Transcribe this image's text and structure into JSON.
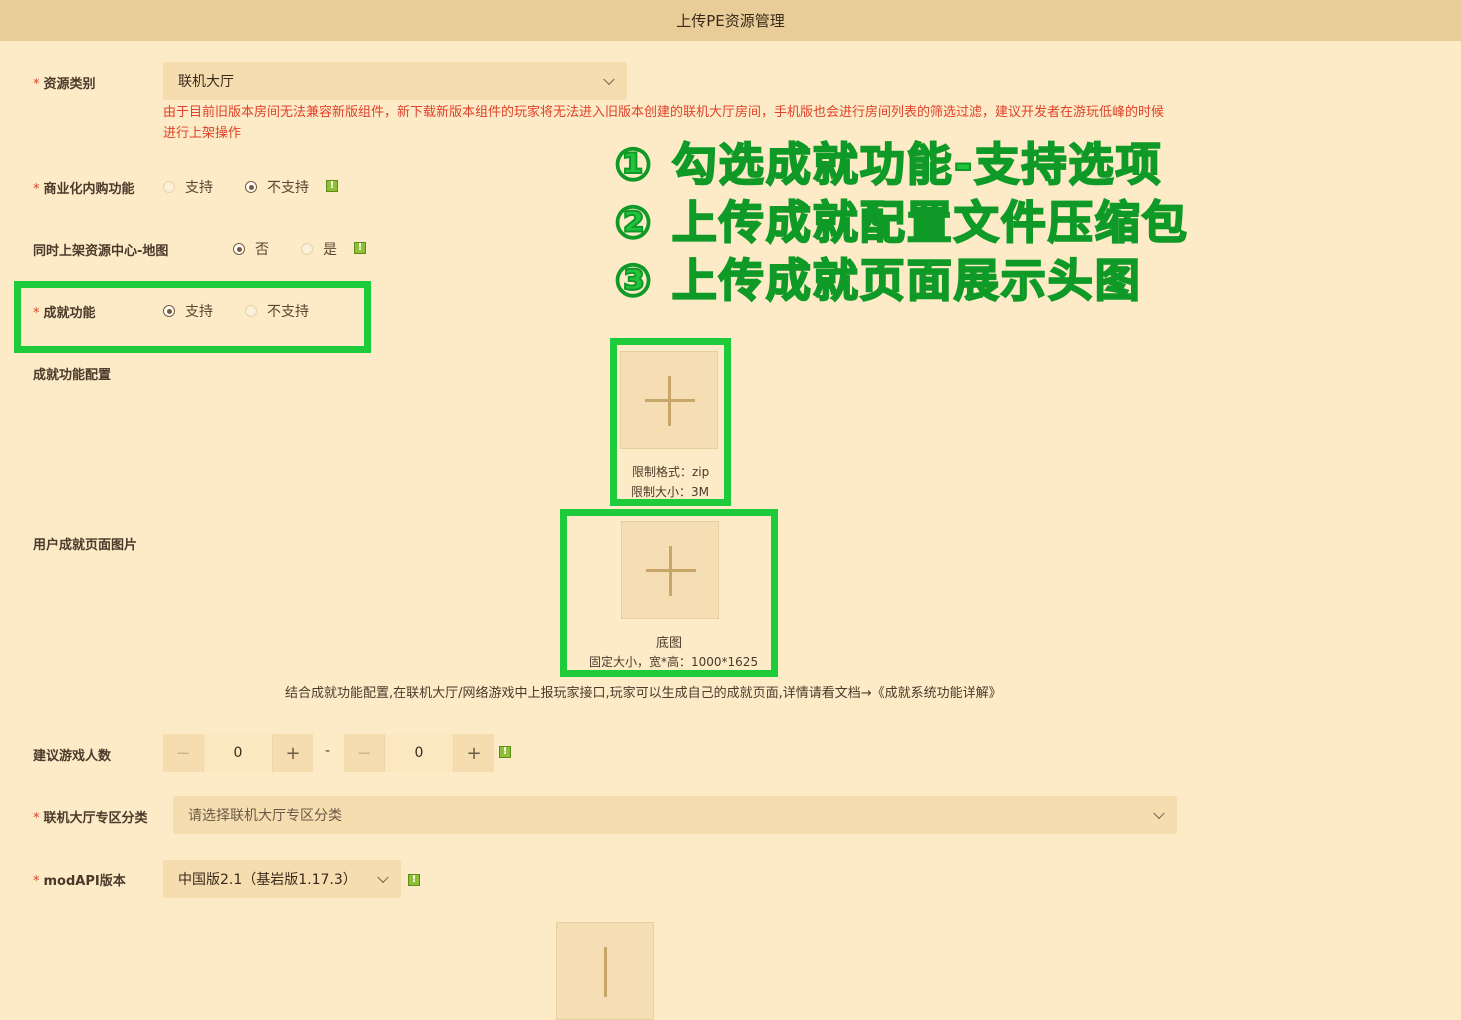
{
  "window": {
    "title": "上传PE资源管理"
  },
  "form": {
    "resource_type": {
      "label": "资源类别",
      "value": "联机大厅"
    },
    "warning": "由于目前旧版本房间无法兼容新版组件，新下载新版本组件的玩家将无法进入旧版本创建的联机大厅房间，手机版也会进行房间列表的筛选过滤，建议开发者在游玩低峰的时候进行上架操作",
    "commercial": {
      "label": "商业化内购功能",
      "options": [
        "支持",
        "不支持"
      ],
      "selected": "不支持"
    },
    "sync_map": {
      "label": "同时上架资源中心-地图",
      "options": [
        "否",
        "是"
      ],
      "selected": "否"
    },
    "achievement": {
      "label": "成就功能",
      "options": [
        "支持",
        "不支持"
      ],
      "selected": "支持"
    },
    "achievement_config": {
      "label": "成就功能配置",
      "hint_format": "限制格式：zip",
      "hint_size": "限制大小：3M"
    },
    "achievement_image": {
      "label": "用户成就页面图片",
      "caption": "底图",
      "size_hint": "固定大小，宽*高：1000*1625"
    },
    "achievement_desc": "结合成就功能配置,在联机大厅/网络游戏中上报玩家接口,玩家可以生成自己的成就页面,详情请看文档→《成就系统功能详解》",
    "players": {
      "label": "建议游戏人数",
      "min": "0",
      "max": "0",
      "separator": "-"
    },
    "lobby_category": {
      "label": "联机大厅专区分类",
      "placeholder": "请选择联机大厅专区分类"
    },
    "mod_api": {
      "label": "modAPI版本",
      "value": "中国版2.1（基岩版1.17.3）"
    }
  },
  "annotations": [
    "① 勾选成就功能-支持选项",
    "② 上传成就配置文件压缩包",
    "③ 上传成就页面展示头图"
  ],
  "colors": {
    "highlight": "#1ecb3a",
    "warning": "#e0412a",
    "background": "#fcebc6"
  }
}
